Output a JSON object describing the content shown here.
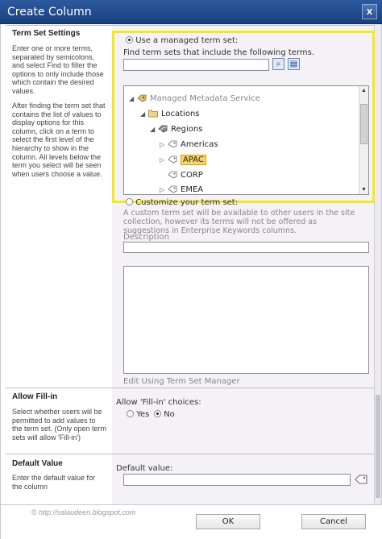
{
  "window": {
    "title": "Create Column",
    "close_label": "x"
  },
  "term_set_settings": {
    "title": "Term Set Settings",
    "desc1": "Enter one or more terms, separated by semicolons, and select Find to filter the options to only include those which contain the desired values.",
    "desc2": "After finding the term set that contains the list of values to display options for this column, click on a term to select the first level of the hierarchy to show in the column. All levels below the term you select will be seen when users choose a value.",
    "use_managed_label": "Use a managed term set:",
    "find_label": "Find term sets that include the following terms.",
    "find_value": "",
    "tree": {
      "root": "Managed Metadata Service",
      "group": "Locations",
      "termset": "Regions",
      "terms": [
        "Americas",
        "APAC",
        "CORP",
        "EMEA"
      ],
      "selected": "APAC"
    },
    "customize_label": "Customize your term set:",
    "custom_desc": "A custom term set will be available to other users in the site collection, however its terms will not be offered as suggestions in Enterprise Keywords columns.",
    "description_label": "Description",
    "edit_link": "Edit Using Term Set Manager"
  },
  "allow_fillin": {
    "title": "Allow Fill-in",
    "desc": "Select whether users will be permitted to add values to the term set. (Only open term sets will allow 'Fill-in')",
    "label": "Allow 'Fill-in' choices:",
    "yes": "Yes",
    "no": "No",
    "selected": "No"
  },
  "default_value": {
    "title": "Default Value",
    "desc": "Enter the default value for the column",
    "label": "Default value:",
    "value": ""
  },
  "footer": {
    "ok": "OK",
    "cancel": "Cancel",
    "watermark": "© http://salaudeen.blogspot.com"
  },
  "colors": {
    "title_bar": "#1f4a8f",
    "highlight": "#f2ea1c",
    "selected_term": "#f6d46a"
  }
}
